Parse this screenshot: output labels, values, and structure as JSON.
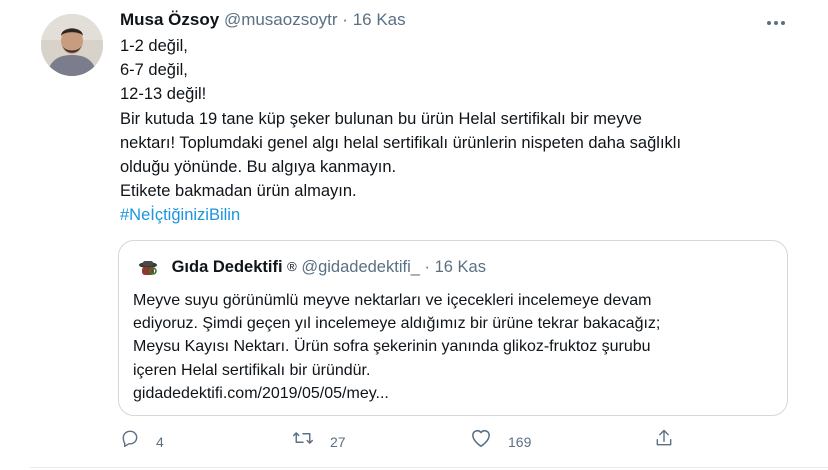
{
  "tweet": {
    "author_name": "Musa Özsoy",
    "author_handle": "@musaozsoytr",
    "separator": "·",
    "date": "16 Kas",
    "more_icon": "more-icon",
    "lines": [
      "1-2 değil,",
      "6-7 değil,",
      "12-13 değil!",
      "Bir kutuda 19 tane küp şeker bulunan bu ürün Helal sertifikalı bir meyve",
      "nektarı! Toplumdaki genel algı helal sertifikalı ürünlerin nispeten daha sağlıklı",
      "olduğu yönünde. Bu algıya kanmayın.",
      "Etikete bakmadan ürün almayın."
    ],
    "hashtag": "#NeİçtiğiniziBilin"
  },
  "quote": {
    "name": "Gıda Dedektifi",
    "badge": "®",
    "handle": "@gidadedektifi_",
    "separator": "·",
    "date": "16 Kas",
    "lines": [
      "Meyve suyu görünümlü meyve nektarları ve içecekleri incelemeye devam",
      "ediyoruz. Şimdi geçen yıl incelemeye aldığımız bir ürüne tekrar bakacağız;",
      "Meysu Kayısı Nektarı. Ürün sofra şekerinin yanında glikoz-fruktoz şurubu",
      "içeren Helal sertifikalı bir üründür.",
      "gidadedektifi.com/2019/05/05/mey..."
    ]
  },
  "actions": {
    "reply_count": "4",
    "retweet_count": "27",
    "like_count": "169"
  },
  "colors": {
    "text": "#0f1419",
    "muted": "#5b7083",
    "link": "#1b95e0",
    "border": "#cfd9de"
  }
}
